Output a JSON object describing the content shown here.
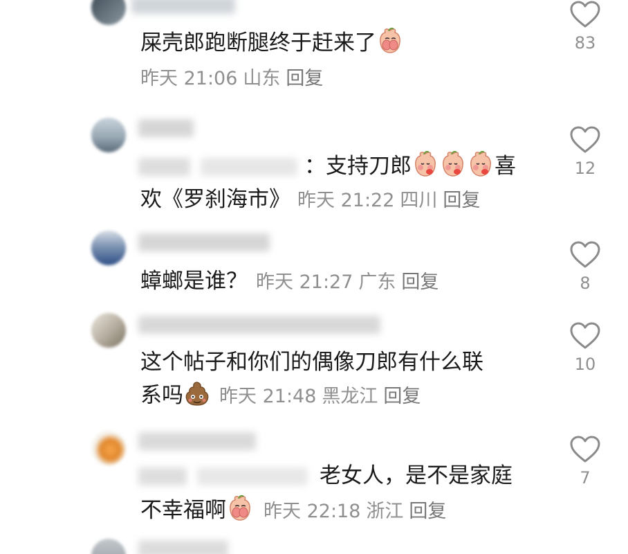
{
  "comments": [
    {
      "text": "屎壳郎跑断腿终于赶来了",
      "emoji": "peach-cover-face-emoji",
      "meta": {
        "time": "昨天 21:06",
        "location": "山东",
        "reply": "回复"
      },
      "likes": "83"
    },
    {
      "text_a": "：支持刀郎",
      "emojis": [
        "peach-blush-emoji",
        "peach-blush-emoji",
        "peach-blush-emoji"
      ],
      "text_b": "喜",
      "text_c": "欢《罗刹海市》",
      "meta": {
        "time": "昨天 21:22",
        "location": "四川",
        "reply": "回复"
      },
      "likes": "12"
    },
    {
      "text": "蟑螂是谁？",
      "meta": {
        "time": "昨天 21:27",
        "location": "广东",
        "reply": "回复"
      },
      "likes": "8"
    },
    {
      "text_a": "这个帖子和你们的偶像刀郎有什么联",
      "text_b": "系吗",
      "emoji": "poop-emoji",
      "meta": {
        "time": "昨天 21:48",
        "location": "黑龙江",
        "reply": "回复"
      },
      "likes": "10"
    },
    {
      "text_a": "老女人，是不是家庭",
      "text_b": "不幸福啊",
      "emoji": "peach-cover-face-emoji",
      "meta": {
        "time": "昨天 22:18",
        "location": "浙江",
        "reply": "回复"
      },
      "likes": "7"
    }
  ],
  "colors": {
    "text": "#1a1a1a",
    "meta": "#8f8f8f",
    "heart": "#8a8a8a"
  }
}
